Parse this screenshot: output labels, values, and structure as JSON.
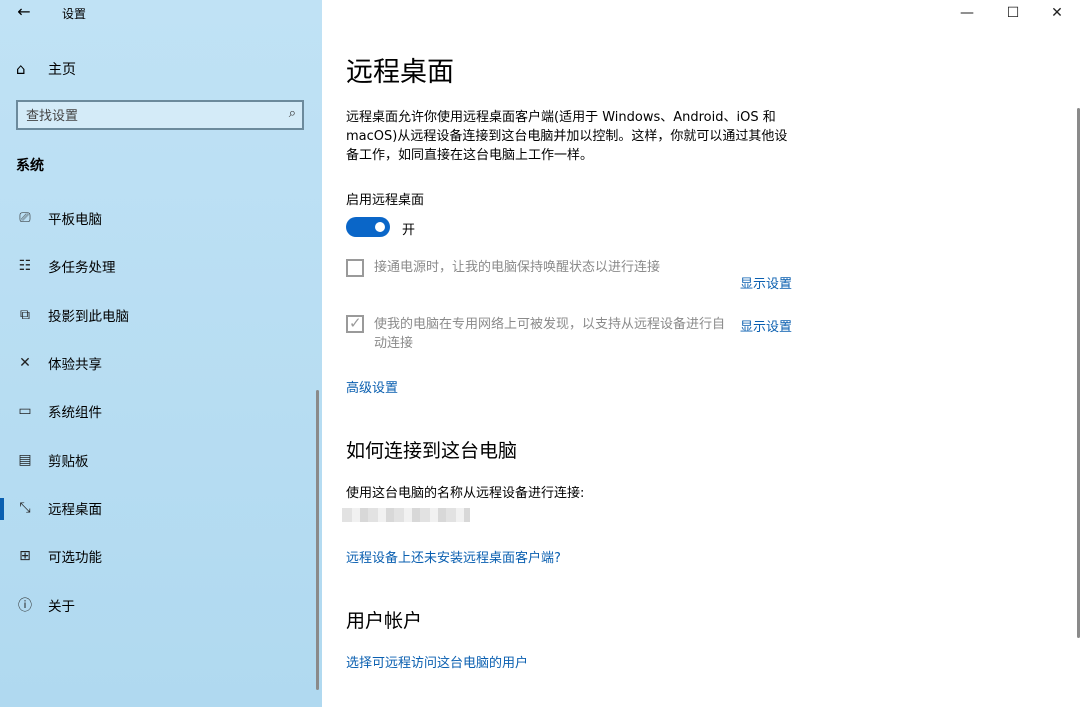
{
  "window": {
    "title": "设置",
    "back_icon": "arrow-left-icon"
  },
  "sidebar": {
    "home_label": "主页",
    "search_placeholder": "查找设置",
    "section": "系统",
    "items": [
      {
        "label": "平板电脑",
        "icon": "tablet-icon"
      },
      {
        "label": "多任务处理",
        "icon": "multitask-icon"
      },
      {
        "label": "投影到此电脑",
        "icon": "projector-icon"
      },
      {
        "label": "体验共享",
        "icon": "share-icon"
      },
      {
        "label": "系统组件",
        "icon": "components-icon"
      },
      {
        "label": "剪贴板",
        "icon": "clipboard-icon"
      },
      {
        "label": "远程桌面",
        "icon": "remote-desktop-icon",
        "active": true
      },
      {
        "label": "可选功能",
        "icon": "optional-features-icon"
      },
      {
        "label": "关于",
        "icon": "info-icon"
      }
    ]
  },
  "main": {
    "title": "远程桌面",
    "description": "远程桌面允许你使用远程桌面客户端(适用于 Windows、Android、iOS 和 macOS)从远程设备连接到这台电脑并加以控制。这样，你就可以通过其他设备工作，如同直接在这台电脑上工作一样。",
    "enable_label": "启用远程桌面",
    "toggle_state": "开",
    "checkbox1": {
      "text": "接通电源时，让我的电脑保持唤醒状态以进行连接",
      "checked": false,
      "link": "显示设置"
    },
    "checkbox2": {
      "text": "使我的电脑在专用网络上可被发现，以支持从远程设备进行自动连接",
      "checked": true,
      "link": "显示设置"
    },
    "advanced_link": "高级设置",
    "connect_heading": "如何连接到这台电脑",
    "connect_text": "使用这台电脑的名称从远程设备进行连接:",
    "client_link": "远程设备上还未安装远程桌面客户端?",
    "user_heading": "用户帐户",
    "user_link": "选择可远程访问这台电脑的用户"
  },
  "colors": {
    "sidebar_bg": "#b8dcf2",
    "accent": "#0a66c8",
    "link": "#0a5fb0"
  }
}
